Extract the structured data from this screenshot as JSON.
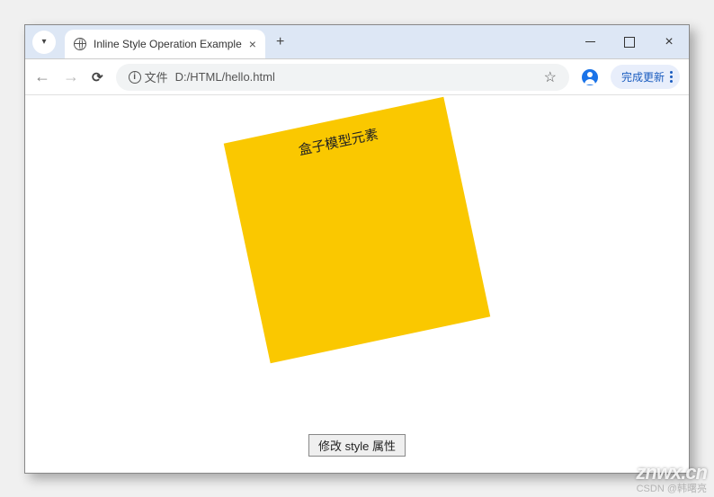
{
  "browser": {
    "tab": {
      "title": "Inline Style Operation Example"
    },
    "address": {
      "file_label": "文件",
      "path": "D:/HTML/hello.html"
    },
    "update_label": "完成更新"
  },
  "page": {
    "box_text": "盒子模型元素",
    "button_label": "修改 style 属性",
    "box_color": "#fac800"
  },
  "watermark": {
    "logo": "znwx.cn",
    "sub": "CSDN @韩曙亮"
  }
}
